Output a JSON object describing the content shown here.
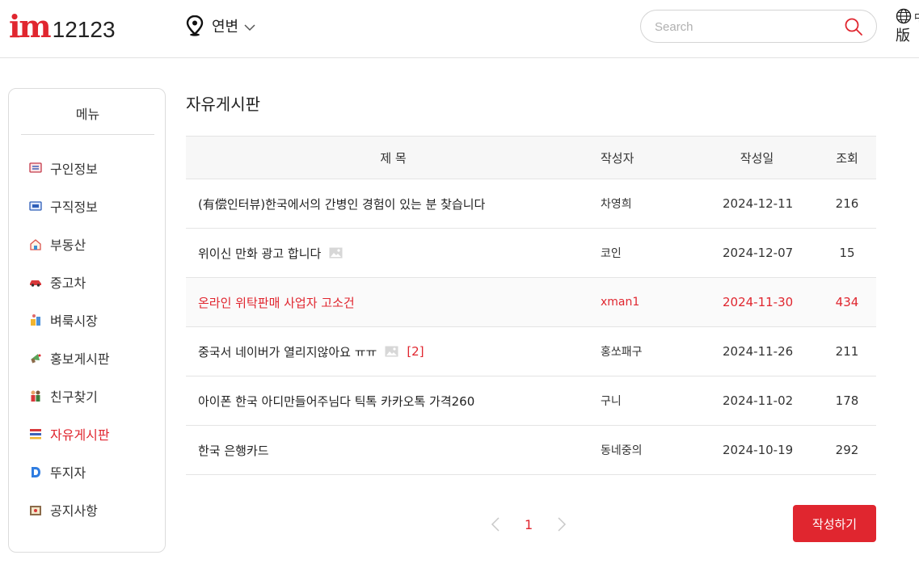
{
  "header": {
    "logo_im": "im",
    "logo_num": "12123",
    "location": "연변",
    "search_placeholder": "Search",
    "lang_cut": "中",
    "lang_text": "版"
  },
  "sidebar": {
    "title": "메뉴",
    "items": [
      {
        "label": "구인정보",
        "icon": "job-posting-icon"
      },
      {
        "label": "구직정보",
        "icon": "job-seeking-icon"
      },
      {
        "label": "부동산",
        "icon": "house-icon"
      },
      {
        "label": "중고차",
        "icon": "car-icon"
      },
      {
        "label": "벼룩시장",
        "icon": "flea-market-icon"
      },
      {
        "label": "홍보게시판",
        "icon": "megaphone-icon"
      },
      {
        "label": "친구찾기",
        "icon": "friends-icon"
      },
      {
        "label": "자유게시판",
        "icon": "board-icon",
        "active": true
      },
      {
        "label": "뚜지자",
        "icon": "d-letter-icon"
      },
      {
        "label": "공지사항",
        "icon": "notice-icon"
      }
    ]
  },
  "main": {
    "title": "자유게시판",
    "columns": {
      "title": "제 목",
      "author": "작성자",
      "date": "작성일",
      "views": "조회"
    },
    "posts": [
      {
        "title": "(有偿인터뷰)한국에서의 간병인 경험이 있는 분 찾습니다",
        "author": "차영희",
        "date": "2024-12-11",
        "views": "216"
      },
      {
        "title": "위이신 만화 광고 합니다",
        "author": "코인",
        "date": "2024-12-07",
        "views": "15",
        "has_image": true
      },
      {
        "title": "온라인 위탁판매 사업자 고소건",
        "author": "xman1",
        "date": "2024-11-30",
        "views": "434",
        "highlight": true
      },
      {
        "title": "중국서 네이버가 열리지않아요 ㅠㅠ",
        "author": "홍쏘패구",
        "date": "2024-11-26",
        "views": "211",
        "has_image": true,
        "comments": "[2]"
      },
      {
        "title": "아이폰 한국 아디만들어주님다 틱톡 카카오톡 가격260",
        "author": "구니",
        "date": "2024-11-02",
        "views": "178"
      },
      {
        "title": "한국 은행카드",
        "author": "동네중의",
        "date": "2024-10-19",
        "views": "292"
      }
    ],
    "pagination": {
      "current": "1"
    },
    "write_button": "작성하기"
  },
  "colors": {
    "accent": "#e0262f"
  }
}
